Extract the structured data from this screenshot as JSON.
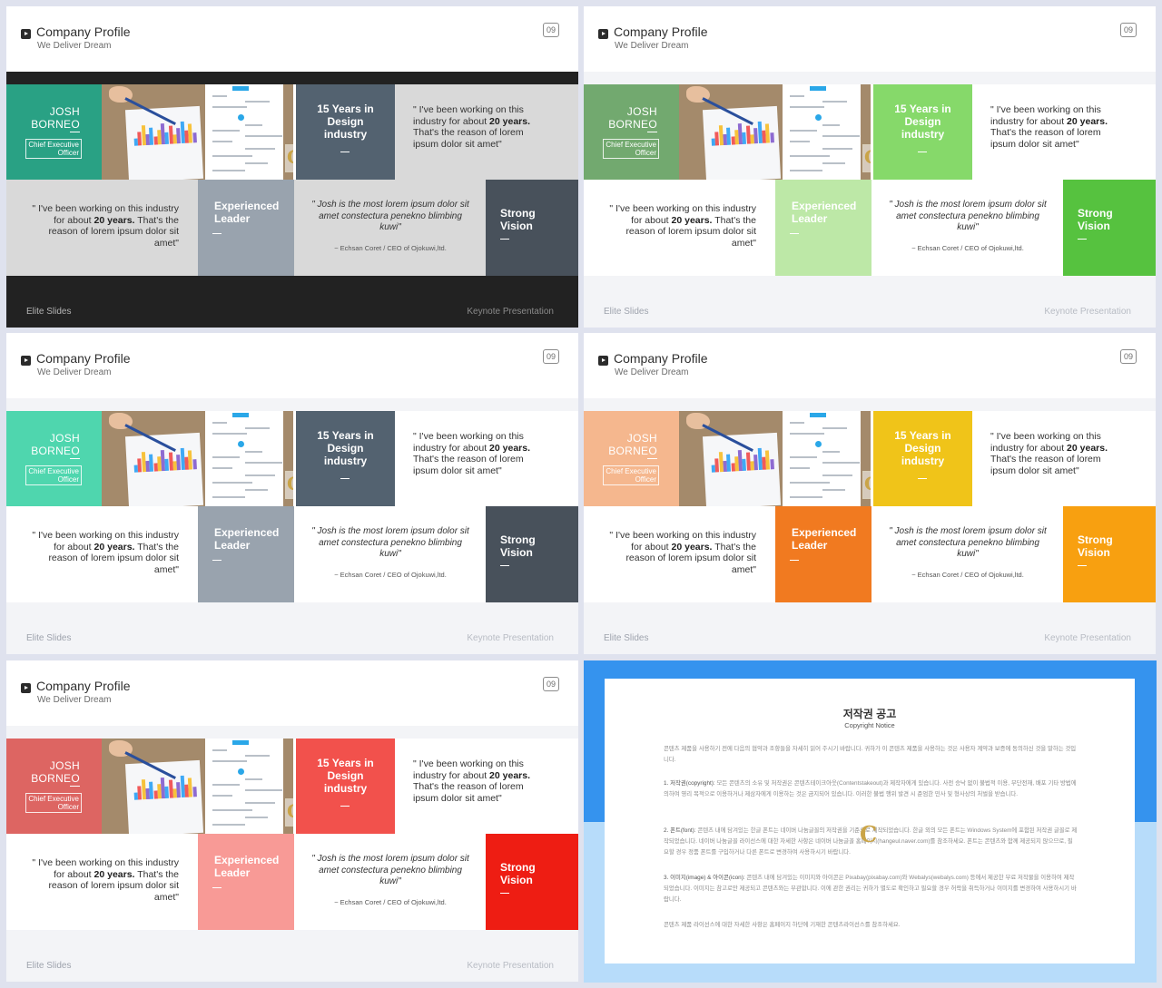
{
  "slide": {
    "title": "Company Profile",
    "subtitle": "We Deliver Dream",
    "page_number": "09",
    "person": {
      "first_name": "JOSH",
      "last_name": "BORNEO",
      "role_line1": "Chief Executive",
      "role_line2": "Officer"
    },
    "feature_years": {
      "line1": "15 Years in",
      "line2": "Design",
      "line3": "industry"
    },
    "feature_leader": {
      "line1": "Experienced",
      "line2": "Leader"
    },
    "feature_vision": {
      "line1": "Strong",
      "line2": "Vision"
    },
    "quote": {
      "pre": "\" I've been working on this industry for about ",
      "bold": "20 years.",
      "post": " That's the reason of lorem ipsum dolor sit amet\""
    },
    "quote_alt": {
      "pre": "\" I've been working on this industry for about ",
      "bold": "20 years.",
      "post": " That's the reason of lorem ipsum dolor sit amet\""
    },
    "testimonial": "\" Josh is the most lorem ipsum dolor sit amet constectura penekno blimbing kuwi\"",
    "attribution": "~ Echsan Coret / CEO of Ojokuwi,ltd.",
    "coin_letter": "C",
    "footer_left": "Elite Slides",
    "footer_right": "Keynote Presentation"
  },
  "themes": [
    {
      "name": "dark-teal",
      "page_bg": "#222222",
      "band": "#222222",
      "josh": "#29a184",
      "years": "#536270",
      "quote_bg": "#d9d9d9",
      "quote2_bg": "#d9d9d9",
      "leader": "#99a3ae",
      "testimonial_bg": "#d9d9d9",
      "vision": "#48515b",
      "years_dash": "#ffffff"
    },
    {
      "name": "green",
      "page_bg": "#f3f4f7",
      "band": "#f3f4f7",
      "josh": "#72a96f",
      "years": "#86d96a",
      "quote_bg": "#ffffff",
      "quote2_bg": "#ffffff",
      "leader": "#bde8a7",
      "testimonial_bg": "#ffffff",
      "vision": "#56c23f",
      "years_dash": "#ffffff"
    },
    {
      "name": "mint",
      "page_bg": "#f3f4f7",
      "band": "#f3f4f7",
      "josh": "#4fd6ae",
      "years": "#536270",
      "quote_bg": "#ffffff",
      "quote2_bg": "#ffffff",
      "leader": "#99a3ae",
      "testimonial_bg": "#ffffff",
      "vision": "#48515b",
      "years_dash": "#ffffff"
    },
    {
      "name": "orange",
      "page_bg": "#f3f4f7",
      "band": "#f3f4f7",
      "josh": "#f5b78e",
      "years": "#f0c419",
      "quote_bg": "#ffffff",
      "quote2_bg": "#ffffff",
      "leader": "#f17a20",
      "testimonial_bg": "#ffffff",
      "vision": "#f8a010",
      "years_dash": "#ffffff"
    },
    {
      "name": "red",
      "page_bg": "#f3f4f7",
      "band": "#f3f4f7",
      "josh": "#dd6562",
      "years": "#f2514c",
      "quote_bg": "#ffffff",
      "quote2_bg": "#ffffff",
      "leader": "#f89a96",
      "testimonial_bg": "#ffffff",
      "vision": "#ee1d13",
      "years_dash": "#ffffff"
    }
  ],
  "copyright": {
    "title": "저작권 공고",
    "subtitle": "Copyright Notice",
    "intro": "콘텐츠 제품을 사용하기 전에 다음의 협약과 조항들을 자세히 읽어 주시기 바랍니다. 귀하가 이 콘텐츠 제품을 사용하는 것은 사용자 계약과 보증에 동의하신 것을 말하는 것입니다.",
    "item1_label": "1. 저작권(copyright):",
    "item1_text": " 모든 콘텐츠의 소유 및 저작권은 콘텐츠테이크아웃(Contentstakeout)과 제작자에게 있습니다. 사전 승낙 없이 불법적 이용, 무단전재, 배포 기타 방법에 의하여 영리 목적으로 이용하거나 제삼자에게 이용하는 것은 금지되어 있습니다. 이러한 불법 행위 발견 시 준엄한 민사 및 형사상의 처벌을 받습니다.",
    "item2_label": "2. 폰트(font):",
    "item2_text": " 콘텐츠 내에 담겨있는 한글 폰트는 네이버 나눔글꼴의 저작권을 기준으로 제작되었습니다. 한글 외의 모든 폰트는 Windows System에 포함된 저작권 글꼴로 제작되었습니다. 네이버 나눔글꼴 라이선스에 대한 자세한 사항은 네이버 나눔글꼴 홈페이지(hangeul.naver.com)를 참조하세요. 폰트는 콘텐츠와 함께 제공되지 않으므로, 필요할 경우 정품 폰트를 구입하거나 다른 폰트로 변경하여 사용하시기 바랍니다.",
    "item3_label": "3. 이미지(image) & 아이콘(icon):",
    "item3_text": " 콘텐츠 내에 담겨있는 이미지와 아이콘은 Pixabay(pixabay.com)와 Webalys(webalys.com) 등에서 제공한 무료 저작물을 이용하여 제작되었습니다. 이미지는 참고로만 제공되고 콘텐츠와는 무관합니다. 이에 관한 권리는 귀하가 별도로 확인하고 필요할 경우 허락을 취득하거나 이미지를 변경하여 사용하시기 바랍니다.",
    "outro": "콘텐츠 제품 라이선스에 대한 자세한 사항은 홈페이지 하단에 기재한 콘텐츠라이선스를 참조하세요.",
    "coin_letter": "C",
    "colors": {
      "top": "#3593ee",
      "bottom": "#b7dcfa"
    }
  },
  "chart_bar_colors": [
    "#3fa9f5",
    "#f15a5a",
    "#f7c23b",
    "#8e6bd1"
  ]
}
